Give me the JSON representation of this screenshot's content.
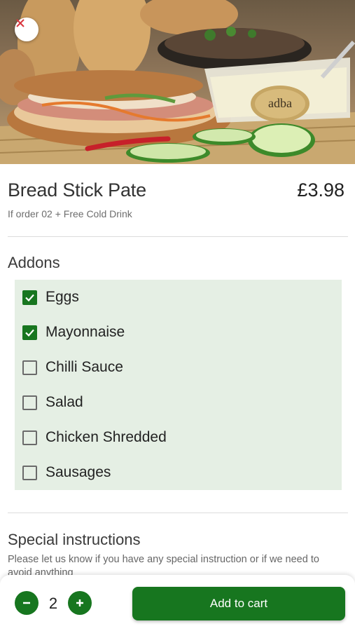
{
  "product": {
    "title": "Bread Stick Pate",
    "price": "£3.98",
    "subtitle": "If order 02 + Free Cold Drink",
    "image_logo_text": "adba"
  },
  "addons": {
    "title": "Addons",
    "items": [
      {
        "label": "Eggs",
        "checked": true
      },
      {
        "label": "Mayonnaise",
        "checked": true
      },
      {
        "label": "Chilli Sauce",
        "checked": false
      },
      {
        "label": "Salad",
        "checked": false
      },
      {
        "label": "Chicken Shredded",
        "checked": false
      },
      {
        "label": "Sausages",
        "checked": false
      }
    ]
  },
  "instructions": {
    "title": "Special instructions",
    "text": "Please let us know if you have any special instruction or if we need to avoid anything"
  },
  "cart": {
    "quantity": "2",
    "add_label": "Add to cart"
  },
  "icons": {
    "close": "close-icon",
    "minus": "minus-icon",
    "plus": "plus-icon",
    "check": "check-icon"
  },
  "colors": {
    "accent": "#17761f",
    "addons_bg": "#e5efe4",
    "close_x": "#d9363e"
  }
}
